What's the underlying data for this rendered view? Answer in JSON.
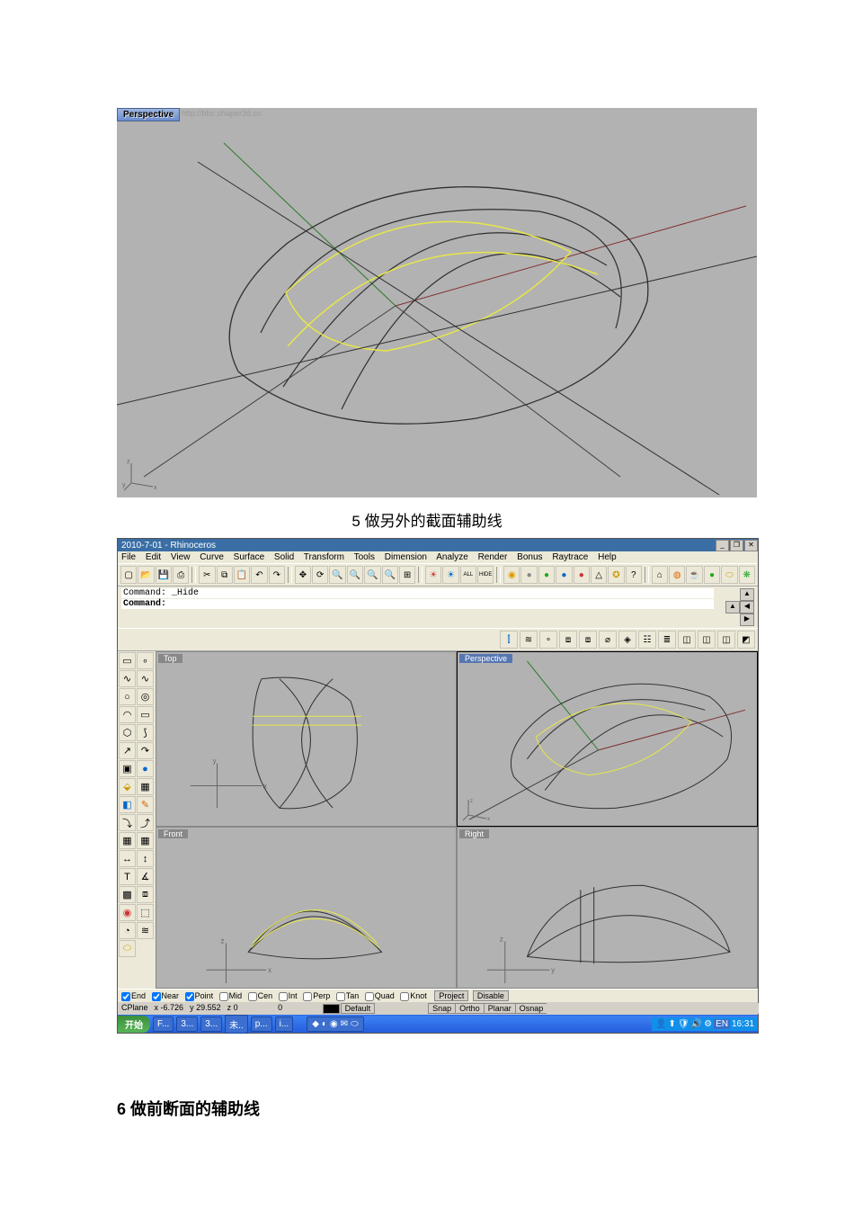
{
  "caption5": "5 做另外的截面辅助线",
  "caption6": "6 做前断面的辅助线",
  "fig1": {
    "viewport_label": "Perspective",
    "watermark": "http://bbs.shaper3d.cn"
  },
  "app": {
    "title": "2010-7-01 - Rhinoceros",
    "win_buttons": [
      "_",
      "❐",
      "✕"
    ],
    "menu": [
      "File",
      "Edit",
      "View",
      "Curve",
      "Surface",
      "Solid",
      "Transform",
      "Tools",
      "Dimension",
      "Analyze",
      "Render",
      "Bonus",
      "Raytrace",
      "Help"
    ],
    "command_history": "Command: _Hide",
    "command_prompt": "Command:",
    "viewports": {
      "top": "Top",
      "persp": "Perspective",
      "front": "Front",
      "right": "Right"
    },
    "osnap": {
      "options": [
        {
          "label": "End",
          "checked": true
        },
        {
          "label": "Near",
          "checked": true
        },
        {
          "label": "Point",
          "checked": true
        },
        {
          "label": "Mid",
          "checked": false
        },
        {
          "label": "Cen",
          "checked": false
        },
        {
          "label": "Int",
          "checked": false
        },
        {
          "label": "Perp",
          "checked": false
        },
        {
          "label": "Tan",
          "checked": false
        },
        {
          "label": "Quad",
          "checked": false
        },
        {
          "label": "Knot",
          "checked": false
        }
      ],
      "project": "Project",
      "disable": "Disable"
    },
    "status": {
      "cplane": "CPlane",
      "x": "x -6.726",
      "y": "y 29.552",
      "z": "z 0",
      "dist": "0",
      "layer": "Default",
      "toggles": [
        "Snap",
        "Ortho",
        "Planar",
        "Osnap"
      ]
    },
    "taskbar": {
      "start": "开始",
      "tasks": [
        "F...",
        "3...",
        "3...",
        "未..",
        "p...",
        "i..."
      ],
      "lang": "EN",
      "clock": "16:31"
    }
  }
}
